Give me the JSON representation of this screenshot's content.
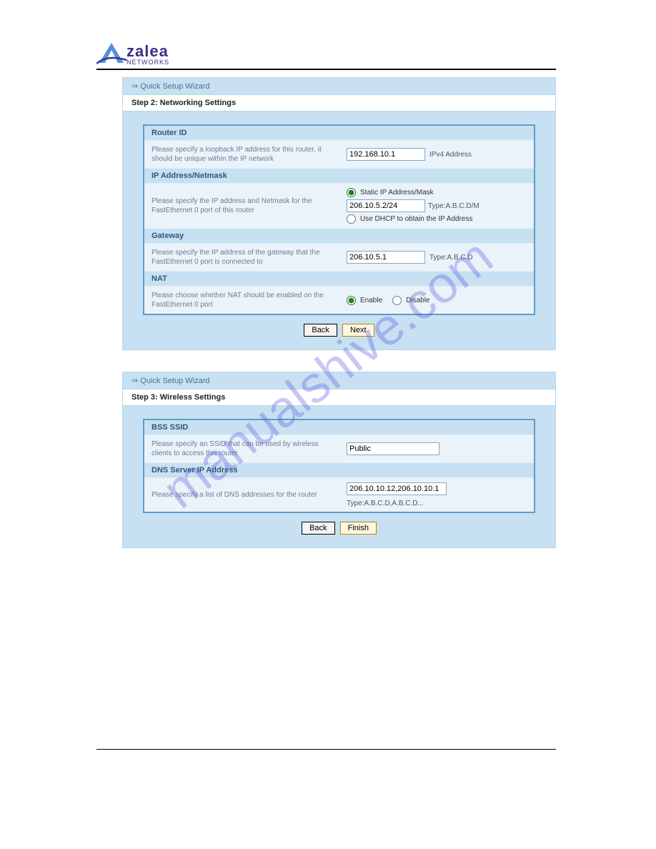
{
  "brand": {
    "name": "zalea",
    "sub": "NETWORKS"
  },
  "watermark": "manualshive.com",
  "wizard_title": "⇒ Quick Setup Wizard",
  "step2": {
    "title": "Step 2: Networking Settings",
    "router_id": {
      "head": "Router ID",
      "desc": "Please specify a loopback IP address for this router, it should be unique within the IP network",
      "value": "192.168.10.1",
      "suffix": "IPv4 Address"
    },
    "ip_netmask": {
      "head": "IP Address/Netmask",
      "desc": "Please specify the IP address and Netmask for the FastEthernet 0 port of this router",
      "opt_static": "Static IP Address/Mask",
      "value": "206.10.5.2/24",
      "type": "Type:A.B.C.D/M",
      "opt_dhcp": "Use DHCP to obtain the IP Address"
    },
    "gateway": {
      "head": "Gateway",
      "desc": "Please specify the IP address of the gateway that the FastEthernet 0 port is connected to",
      "value": "206.10.5.1",
      "type": "Type:A.B.C.D"
    },
    "nat": {
      "head": "NAT",
      "desc": "Please choose whether NAT should be enabled on the FastEthernet 0 port",
      "enable": "Enable",
      "disable": "Disable"
    },
    "back": "Back",
    "next": "Next"
  },
  "step3": {
    "title": "Step 3: Wireless Settings",
    "ssid": {
      "head": "BSS SSID",
      "desc": "Please specify an SSID that can be used by wireless clients to access this router",
      "value": "Public"
    },
    "dns": {
      "head": "DNS Server IP Address",
      "desc": "Please specify a list of DNS addresses for the router",
      "value": "206.10.10.12,206.10.10.1",
      "type": "Type:A.B.C.D,A.B.C.D..."
    },
    "back": "Back",
    "finish": "Finish"
  }
}
